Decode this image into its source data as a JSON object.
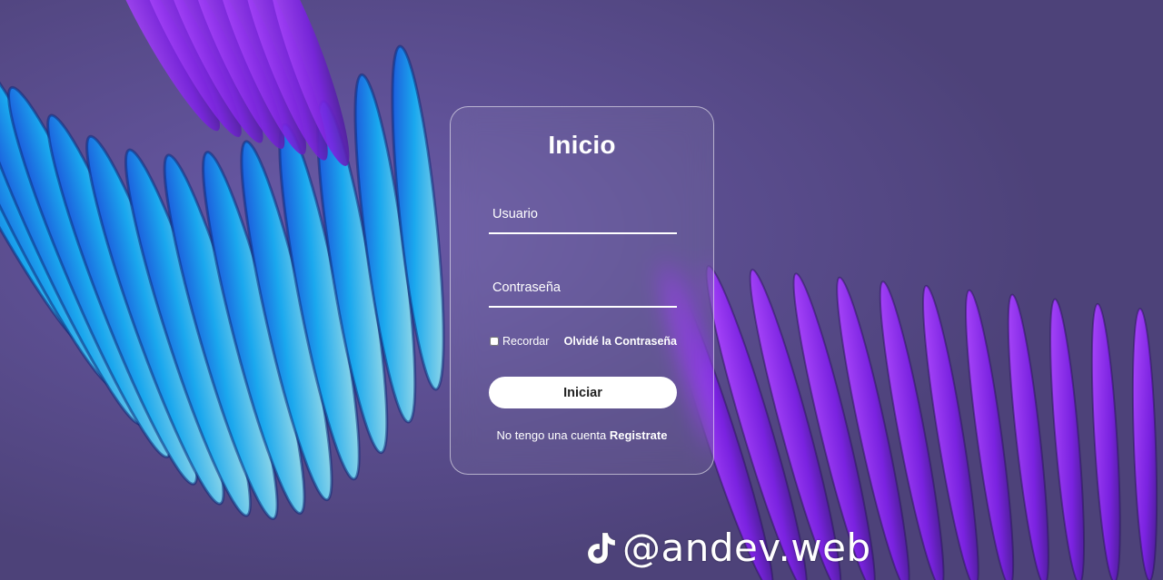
{
  "login": {
    "title": "Inicio",
    "username_placeholder": "Usuario",
    "password_placeholder": "Contraseña",
    "remember_label": "Recordar",
    "forgot_label": "Olvidé la Contraseña",
    "submit_label": "Iniciar",
    "no_account_text": "No tengo una cuenta",
    "register_label": "Registrate"
  },
  "watermark": {
    "icon": "tiktok-icon",
    "handle": "@andev.web"
  },
  "colors": {
    "background": "#574a86",
    "card_border": "#ffffff",
    "button_bg": "#ffffff",
    "accent_purple": "#8a2be2",
    "accent_cyan": "#21a9e8"
  }
}
